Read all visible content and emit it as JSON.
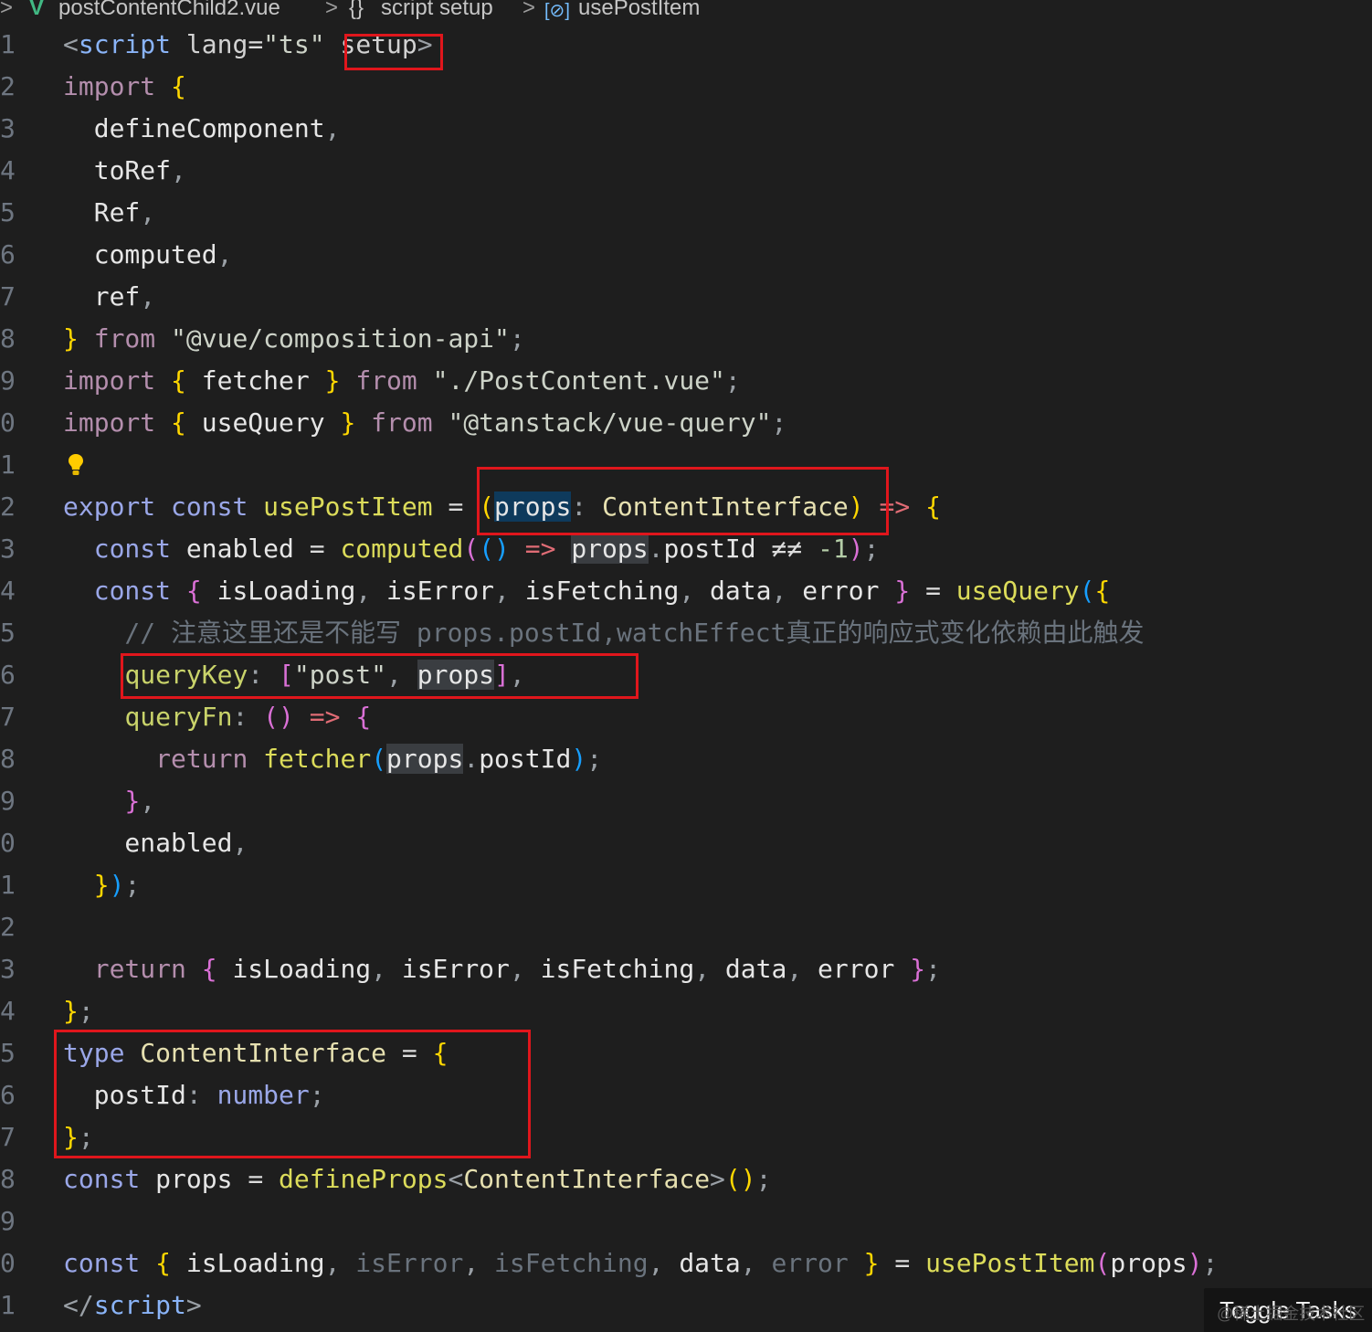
{
  "breadcrumb": {
    "file": "postContentChild2.vue",
    "section_icon": "{}",
    "section": "script setup",
    "symbol_icon": "[⊘]",
    "symbol": "usePostItem",
    "separator": ">"
  },
  "editor": {
    "line_numbers": [
      "1",
      "2",
      "3",
      "4",
      "5",
      "6",
      "7",
      "8",
      "9",
      "0",
      "1",
      "2",
      "3",
      "4",
      "5",
      "6",
      "7",
      "8",
      "9",
      "0",
      "1",
      "2",
      "3",
      "4",
      "5",
      "6",
      "7",
      "8",
      "9",
      "0",
      "1"
    ],
    "lines": [
      [
        [
          "t-punc",
          "<"
        ],
        [
          "t-tag",
          "script"
        ],
        [
          "t-attr",
          " lang"
        ],
        [
          "t-op",
          "="
        ],
        [
          "t-str",
          "\"ts\""
        ],
        [
          "t-attr",
          " "
        ],
        [
          "t-attr",
          "setup"
        ],
        [
          "t-punc",
          ">"
        ]
      ],
      [
        [
          "t-kw2",
          "import"
        ],
        [
          "t-op",
          " "
        ],
        [
          "b1",
          "{"
        ]
      ],
      [
        [
          "t-var",
          "  defineComponent"
        ],
        [
          "t-punc",
          ","
        ]
      ],
      [
        [
          "t-var",
          "  toRef"
        ],
        [
          "t-punc",
          ","
        ]
      ],
      [
        [
          "t-var",
          "  Ref"
        ],
        [
          "t-punc",
          ","
        ]
      ],
      [
        [
          "t-var",
          "  computed"
        ],
        [
          "t-punc",
          ","
        ]
      ],
      [
        [
          "t-var",
          "  ref"
        ],
        [
          "t-punc",
          ","
        ]
      ],
      [
        [
          "b1",
          "}"
        ],
        [
          "t-op",
          " "
        ],
        [
          "t-kw2",
          "from"
        ],
        [
          "t-op",
          " "
        ],
        [
          "t-str",
          "\"@vue/composition-api\""
        ],
        [
          "t-punc",
          ";"
        ]
      ],
      [
        [
          "t-kw2",
          "import"
        ],
        [
          "t-op",
          " "
        ],
        [
          "b1",
          "{"
        ],
        [
          "t-var",
          " fetcher "
        ],
        [
          "b1",
          "}"
        ],
        [
          "t-op",
          " "
        ],
        [
          "t-kw2",
          "from"
        ],
        [
          "t-op",
          " "
        ],
        [
          "t-str",
          "\"./PostContent.vue\""
        ],
        [
          "t-punc",
          ";"
        ]
      ],
      [
        [
          "t-kw2",
          "import"
        ],
        [
          "t-op",
          " "
        ],
        [
          "b1",
          "{"
        ],
        [
          "t-var",
          " useQuery "
        ],
        [
          "b1",
          "}"
        ],
        [
          "t-op",
          " "
        ],
        [
          "t-kw2",
          "from"
        ],
        [
          "t-op",
          " "
        ],
        [
          "t-str",
          "\"@tanstack/vue-query\""
        ],
        [
          "t-punc",
          ";"
        ]
      ],
      [],
      [
        [
          "t-decl",
          "export"
        ],
        [
          "t-op",
          " "
        ],
        [
          "t-decl",
          "const"
        ],
        [
          "t-op",
          " "
        ],
        [
          "t-fn",
          "usePostItem"
        ],
        [
          "t-op",
          " = "
        ],
        [
          "b1",
          "("
        ],
        [
          "t-var hl-sel",
          "props"
        ],
        [
          "t-punc",
          ": "
        ],
        [
          "t-type",
          "ContentInterface"
        ],
        [
          "b1",
          ")"
        ],
        [
          "t-op",
          " "
        ],
        [
          "t-arrow",
          "=>"
        ],
        [
          "t-op",
          " "
        ],
        [
          "b1",
          "{"
        ]
      ],
      [
        [
          "t-op",
          "  "
        ],
        [
          "t-decl",
          "const"
        ],
        [
          "t-var",
          " enabled "
        ],
        [
          "t-op",
          "= "
        ],
        [
          "t-fn",
          "computed"
        ],
        [
          "b2",
          "("
        ],
        [
          "b3",
          "()"
        ],
        [
          "t-op",
          " "
        ],
        [
          "t-arrow",
          "=>"
        ],
        [
          "t-op",
          " "
        ],
        [
          "t-var hl-word",
          "props"
        ],
        [
          "t-punc",
          "."
        ],
        [
          "t-var",
          "postId"
        ],
        [
          "t-op",
          " ≠≠ "
        ],
        [
          "t-num",
          "-1"
        ],
        [
          "b2",
          ")"
        ],
        [
          "t-punc",
          ";"
        ]
      ],
      [
        [
          "t-op",
          "  "
        ],
        [
          "t-decl",
          "const"
        ],
        [
          "t-op",
          " "
        ],
        [
          "b2",
          "{"
        ],
        [
          "t-var",
          " isLoading"
        ],
        [
          "t-punc",
          ","
        ],
        [
          "t-var",
          " isError"
        ],
        [
          "t-punc",
          ","
        ],
        [
          "t-var",
          " isFetching"
        ],
        [
          "t-punc",
          ","
        ],
        [
          "t-var",
          " data"
        ],
        [
          "t-punc",
          ","
        ],
        [
          "t-var",
          " error "
        ],
        [
          "b2",
          "}"
        ],
        [
          "t-op",
          " = "
        ],
        [
          "t-fn",
          "useQuery"
        ],
        [
          "b3",
          "("
        ],
        [
          "b1",
          "{"
        ]
      ],
      [
        [
          "t-com",
          "    // 注意这里还是不能写 props.postId,watchEffect真正的响应式变化依赖由此触发"
        ]
      ],
      [
        [
          "t-op",
          "    "
        ],
        [
          "t-prop",
          "queryKey"
        ],
        [
          "t-punc",
          ": "
        ],
        [
          "b2",
          "["
        ],
        [
          "t-str",
          "\"post\""
        ],
        [
          "t-punc",
          ", "
        ],
        [
          "t-var hl-word",
          "props"
        ],
        [
          "b2",
          "]"
        ],
        [
          "t-punc",
          ","
        ]
      ],
      [
        [
          "t-op",
          "    "
        ],
        [
          "t-prop",
          "queryFn"
        ],
        [
          "t-punc",
          ": "
        ],
        [
          "b2",
          "()"
        ],
        [
          "t-op",
          " "
        ],
        [
          "t-arrow",
          "=>"
        ],
        [
          "t-op",
          " "
        ],
        [
          "b2",
          "{"
        ]
      ],
      [
        [
          "t-op",
          "      "
        ],
        [
          "t-kw2",
          "return"
        ],
        [
          "t-op",
          " "
        ],
        [
          "t-fn",
          "fetcher"
        ],
        [
          "b3",
          "("
        ],
        [
          "t-var hl-word",
          "props"
        ],
        [
          "t-punc",
          "."
        ],
        [
          "t-var",
          "postId"
        ],
        [
          "b3",
          ")"
        ],
        [
          "t-punc",
          ";"
        ]
      ],
      [
        [
          "t-op",
          "    "
        ],
        [
          "b2",
          "}"
        ],
        [
          "t-punc",
          ","
        ]
      ],
      [
        [
          "t-var",
          "    enabled"
        ],
        [
          "t-punc",
          ","
        ]
      ],
      [
        [
          "t-op",
          "  "
        ],
        [
          "b1",
          "}"
        ],
        [
          "b3",
          ")"
        ],
        [
          "t-punc",
          ";"
        ]
      ],
      [],
      [
        [
          "t-op",
          "  "
        ],
        [
          "t-kw2",
          "return"
        ],
        [
          "t-op",
          " "
        ],
        [
          "b2",
          "{"
        ],
        [
          "t-var",
          " isLoading"
        ],
        [
          "t-punc",
          ","
        ],
        [
          "t-var",
          " isError"
        ],
        [
          "t-punc",
          ","
        ],
        [
          "t-var",
          " isFetching"
        ],
        [
          "t-punc",
          ","
        ],
        [
          "t-var",
          " data"
        ],
        [
          "t-punc",
          ","
        ],
        [
          "t-var",
          " error "
        ],
        [
          "b2",
          "}"
        ],
        [
          "t-punc",
          ";"
        ]
      ],
      [
        [
          "b1",
          "}"
        ],
        [
          "t-punc",
          ";"
        ]
      ],
      [
        [
          "t-decl",
          "type"
        ],
        [
          "t-op",
          " "
        ],
        [
          "t-type",
          "ContentInterface"
        ],
        [
          "t-op",
          " = "
        ],
        [
          "b1",
          "{"
        ]
      ],
      [
        [
          "t-var",
          "  postId"
        ],
        [
          "t-punc",
          ": "
        ],
        [
          "t-decl",
          "number"
        ],
        [
          "t-punc",
          ";"
        ]
      ],
      [
        [
          "b1",
          "}"
        ],
        [
          "t-punc",
          ";"
        ]
      ],
      [
        [
          "t-decl",
          "const"
        ],
        [
          "t-var",
          " props "
        ],
        [
          "t-op",
          "= "
        ],
        [
          "t-fn",
          "defineProps"
        ],
        [
          "t-punc",
          "<"
        ],
        [
          "t-type",
          "ContentInterface"
        ],
        [
          "t-punc",
          ">"
        ],
        [
          "b1",
          "()"
        ],
        [
          "t-punc",
          ";"
        ]
      ],
      [],
      [
        [
          "t-decl",
          "const"
        ],
        [
          "t-op",
          " "
        ],
        [
          "b1",
          "{"
        ],
        [
          "t-var",
          " isLoading"
        ],
        [
          "t-punc",
          ","
        ],
        [
          "t-com",
          " isError"
        ],
        [
          "t-punc",
          ","
        ],
        [
          "t-com",
          " isFetching"
        ],
        [
          "t-punc",
          ","
        ],
        [
          "t-var",
          " data"
        ],
        [
          "t-punc",
          ","
        ],
        [
          "t-com",
          " error "
        ],
        [
          "b1",
          "}"
        ],
        [
          "t-op",
          " = "
        ],
        [
          "t-fn",
          "usePostItem"
        ],
        [
          "b2",
          "("
        ],
        [
          "t-var",
          "props"
        ],
        [
          "b2",
          ")"
        ],
        [
          "t-punc",
          ";"
        ]
      ],
      [
        [
          "t-punc",
          "</"
        ],
        [
          "t-tag",
          "script"
        ],
        [
          "t-punc",
          ">"
        ]
      ]
    ]
  },
  "status": {
    "toggle_tasks": "Toggle Tasks",
    "watermark": "@稀土掘金技术社区"
  },
  "colors": {
    "background": "#1e1e1e",
    "highlight_box": "#e0161c"
  },
  "icons": {
    "vue": "vue-file-icon",
    "lightbulb": "lightbulb-icon"
  }
}
